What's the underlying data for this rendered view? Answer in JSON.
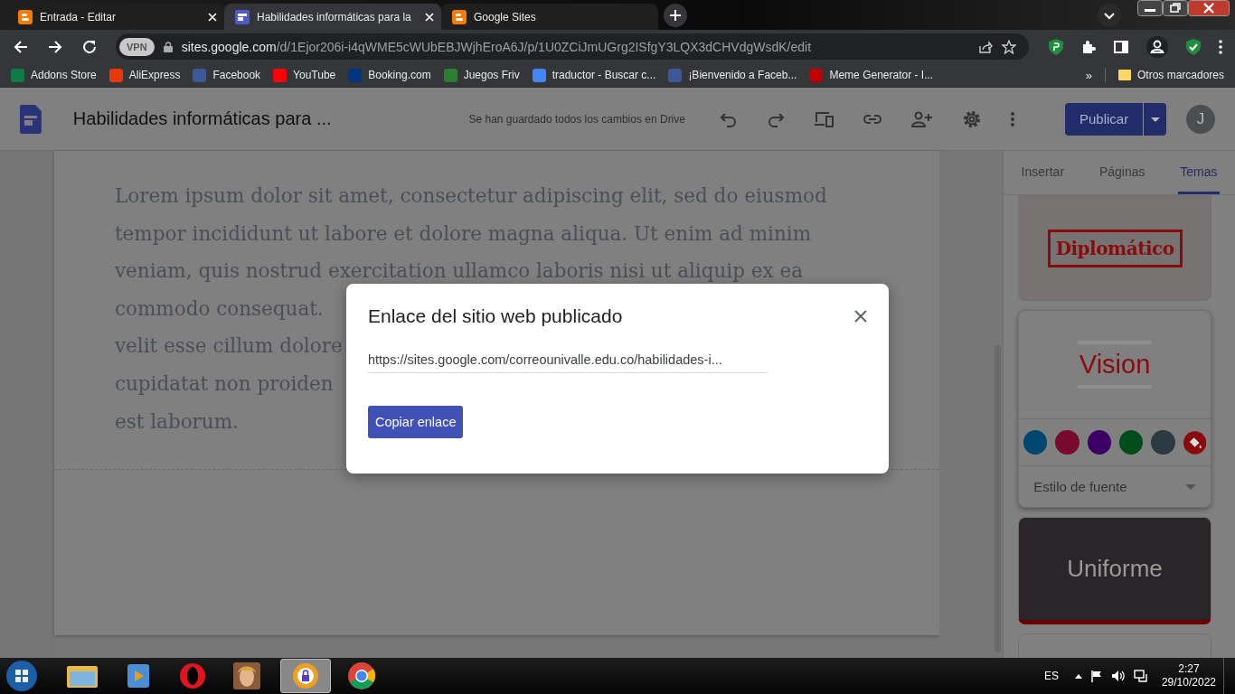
{
  "browser": {
    "tabs": [
      {
        "title": "Entrada - Editar",
        "selected": false,
        "kind": "blogger"
      },
      {
        "title": "Habilidades informáticas para la",
        "selected": true,
        "kind": "sites"
      },
      {
        "title": "Google Sites",
        "selected": false,
        "kind": "blogger"
      }
    ],
    "vpn_label": "VPN",
    "url_host": "sites.google.com",
    "url_path": "/d/1Ejor206i-i4qWME5cWUbEBJWjhEroA6J/p/1U0ZCiJmUGrg2ISfgY3LQX3dCHVdgWsdK/edit",
    "bookmarks": [
      {
        "label": "Addons Store"
      },
      {
        "label": "AliExpress"
      },
      {
        "label": "Facebook"
      },
      {
        "label": "YouTube"
      },
      {
        "label": "Booking.com"
      },
      {
        "label": "Juegos Friv"
      },
      {
        "label": "traductor - Buscar c..."
      },
      {
        "label": "¡Bienvenido a Faceb..."
      },
      {
        "label": "Meme Generator - I..."
      }
    ],
    "more_bookmarks": "»",
    "other_bookmarks": "Otros marcadores"
  },
  "editor": {
    "site_title": "Habilidades informáticas para ...",
    "save_status": "Se han guardado todos los cambios en Drive",
    "publish_label": "Publicar",
    "avatar_initial": "J",
    "body_lines": [
      "Lorem ipsum dolor sit amet, consectetur adipiscing elit, sed do eiusmod",
      "tempor incididunt ut labore et dolore magna aliqua. Ut enim ad minim",
      "veniam, quis nostrud exercitation ullamco laboris nisi ut aliquip ex ea",
      "commodo consequat.",
      "velit esse cillum dolore",
      "cupidatat non proiden",
      "est laborum."
    ],
    "sidebar_tabs": [
      {
        "label": "Insertar",
        "selected": false
      },
      {
        "label": "Páginas",
        "selected": false
      },
      {
        "label": "Temas",
        "selected": true
      }
    ],
    "themes": [
      {
        "name": "Diplomático",
        "kind": "framed",
        "selected": false
      },
      {
        "name": "Vision",
        "kind": "lined",
        "selected": true,
        "colors": [
          {
            "color": "#00476f"
          },
          {
            "color": "#780a30"
          },
          {
            "color": "#3a0066"
          },
          {
            "color": "#004d1c"
          },
          {
            "color": "#2c3a42"
          }
        ],
        "font_style": "Estilo de fuente"
      },
      {
        "name": "Uniforme",
        "kind": "dark",
        "selected": false
      }
    ]
  },
  "dialog": {
    "title": "Enlace del sitio web publicado",
    "url": "https://sites.google.com/correounivalle.edu.co/habilidades-i...",
    "button": "Copiar enlace"
  },
  "taskbar": {
    "language": "ES",
    "time": "2:27",
    "date": "29/10/2022"
  }
}
